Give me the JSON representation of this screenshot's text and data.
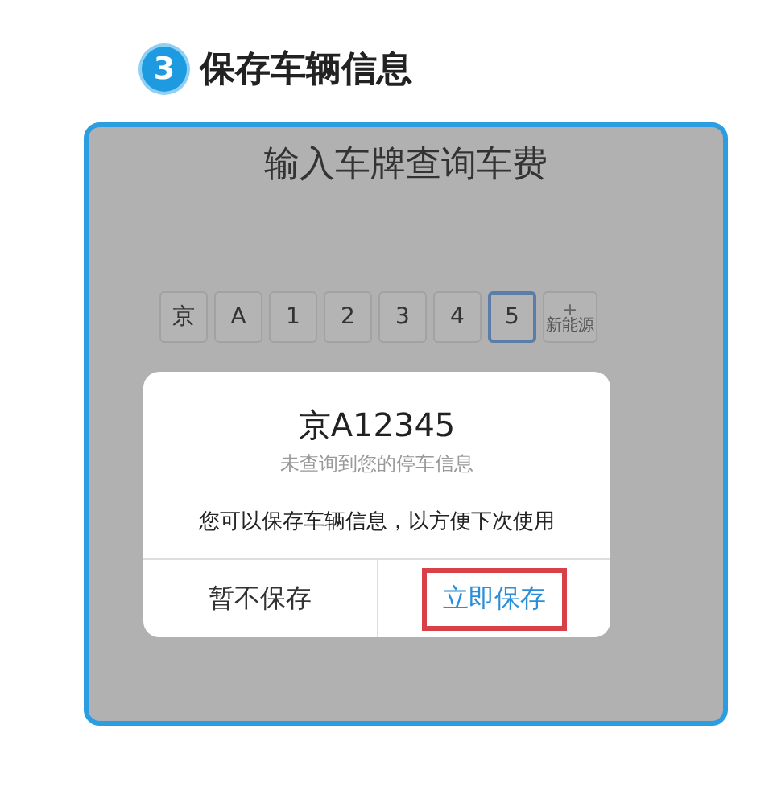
{
  "step": {
    "number": "3",
    "title": "保存车辆信息"
  },
  "screen": {
    "title": "输入车牌查询车费",
    "plate_keys": [
      {
        "label": "京",
        "selected": false
      },
      {
        "label": "A",
        "selected": false
      },
      {
        "label": "1",
        "selected": false
      },
      {
        "label": "2",
        "selected": false
      },
      {
        "label": "3",
        "selected": false
      },
      {
        "label": "4",
        "selected": false
      },
      {
        "label": "5",
        "selected": true
      }
    ],
    "new_energy_key": {
      "symbol": "+",
      "label": "新能源"
    },
    "dialog": {
      "plate": "京A12345",
      "subtitle": "未查询到您的停车信息",
      "message": "您可以保存车辆信息，以方便下次使用",
      "buttons": [
        {
          "label": "暂不保存",
          "kind": "cancel",
          "highlighted": false
        },
        {
          "label": "立即保存",
          "kind": "confirm",
          "highlighted": true
        }
      ]
    }
  }
}
